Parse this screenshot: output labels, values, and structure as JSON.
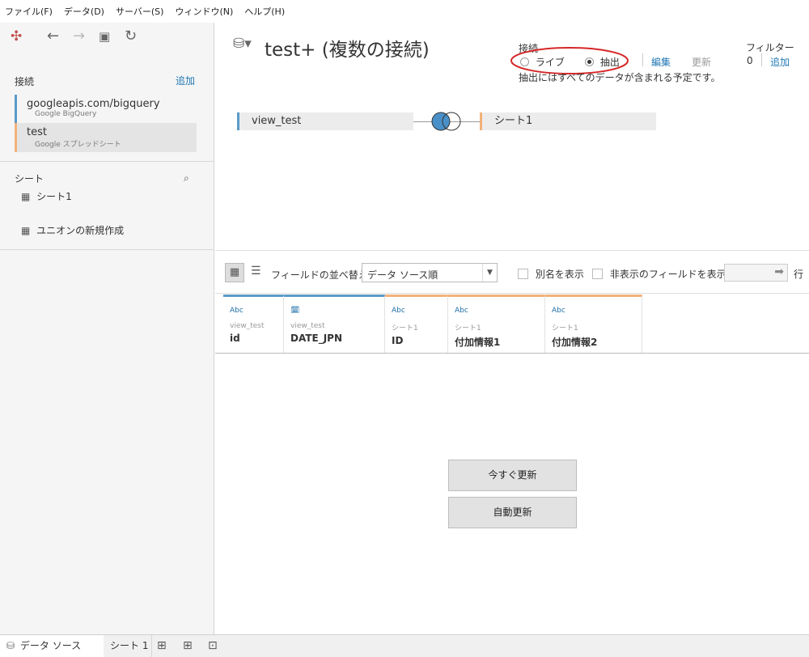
{
  "menu": [
    "ファイル(F)",
    "データ(D)",
    "サーバー(S)",
    "ウィンドウ(N)",
    "ヘルプ(H)"
  ],
  "left": {
    "connections_title": "接続",
    "add_label": "追加",
    "connections": [
      {
        "name": "googleapis.com/bigquery",
        "type": "Google BigQuery",
        "accent": "#5b9bc8"
      },
      {
        "name": "test",
        "type": "Google スプレッドシート",
        "accent": "#f2b27a"
      }
    ],
    "sheets_title": "シート",
    "sheets": [
      "シート1"
    ],
    "new_union": "ユニオンの新規作成"
  },
  "main": {
    "datasource_title": "test+ (複数の接続)",
    "connection_label": "接続",
    "live_label": "ライブ",
    "extract_label": "抽出",
    "edit_label": "編集",
    "refresh_label": "更新",
    "extract_note": "抽出にはすべてのデータが含まれる予定です。",
    "filter_label": "フィルター",
    "filter_count": "0",
    "filter_add": "追加",
    "left_table": "view_test",
    "right_table": "シート1",
    "sort_label": "フィールドの並べ替え",
    "sort_value": "データ ソース順",
    "alias_label": "別名を表示",
    "hidden_label": "非表示のフィールドを表示",
    "rows_label": "行",
    "columns": [
      {
        "type": "Abc",
        "source": "view_test",
        "name": "id"
      },
      {
        "type": "date-icon",
        "source": "view_test",
        "name": "DATE_JPN"
      },
      {
        "type": "Abc",
        "source": "シート1",
        "name": "ID"
      },
      {
        "type": "Abc",
        "source": "シート1",
        "name": "付加情報1"
      },
      {
        "type": "Abc",
        "source": "シート1",
        "name": "付加情報2"
      }
    ],
    "update_now": "今すぐ更新",
    "auto_update": "自動更新"
  },
  "bottom": {
    "datasource_tab": "データ ソース",
    "sheet_tab": "シート 1"
  },
  "colors": {
    "blue_accent": "#5b9bc8",
    "orange_accent": "#f2b27a",
    "link": "#1f77b4",
    "highlight_oval": "#d62728"
  }
}
